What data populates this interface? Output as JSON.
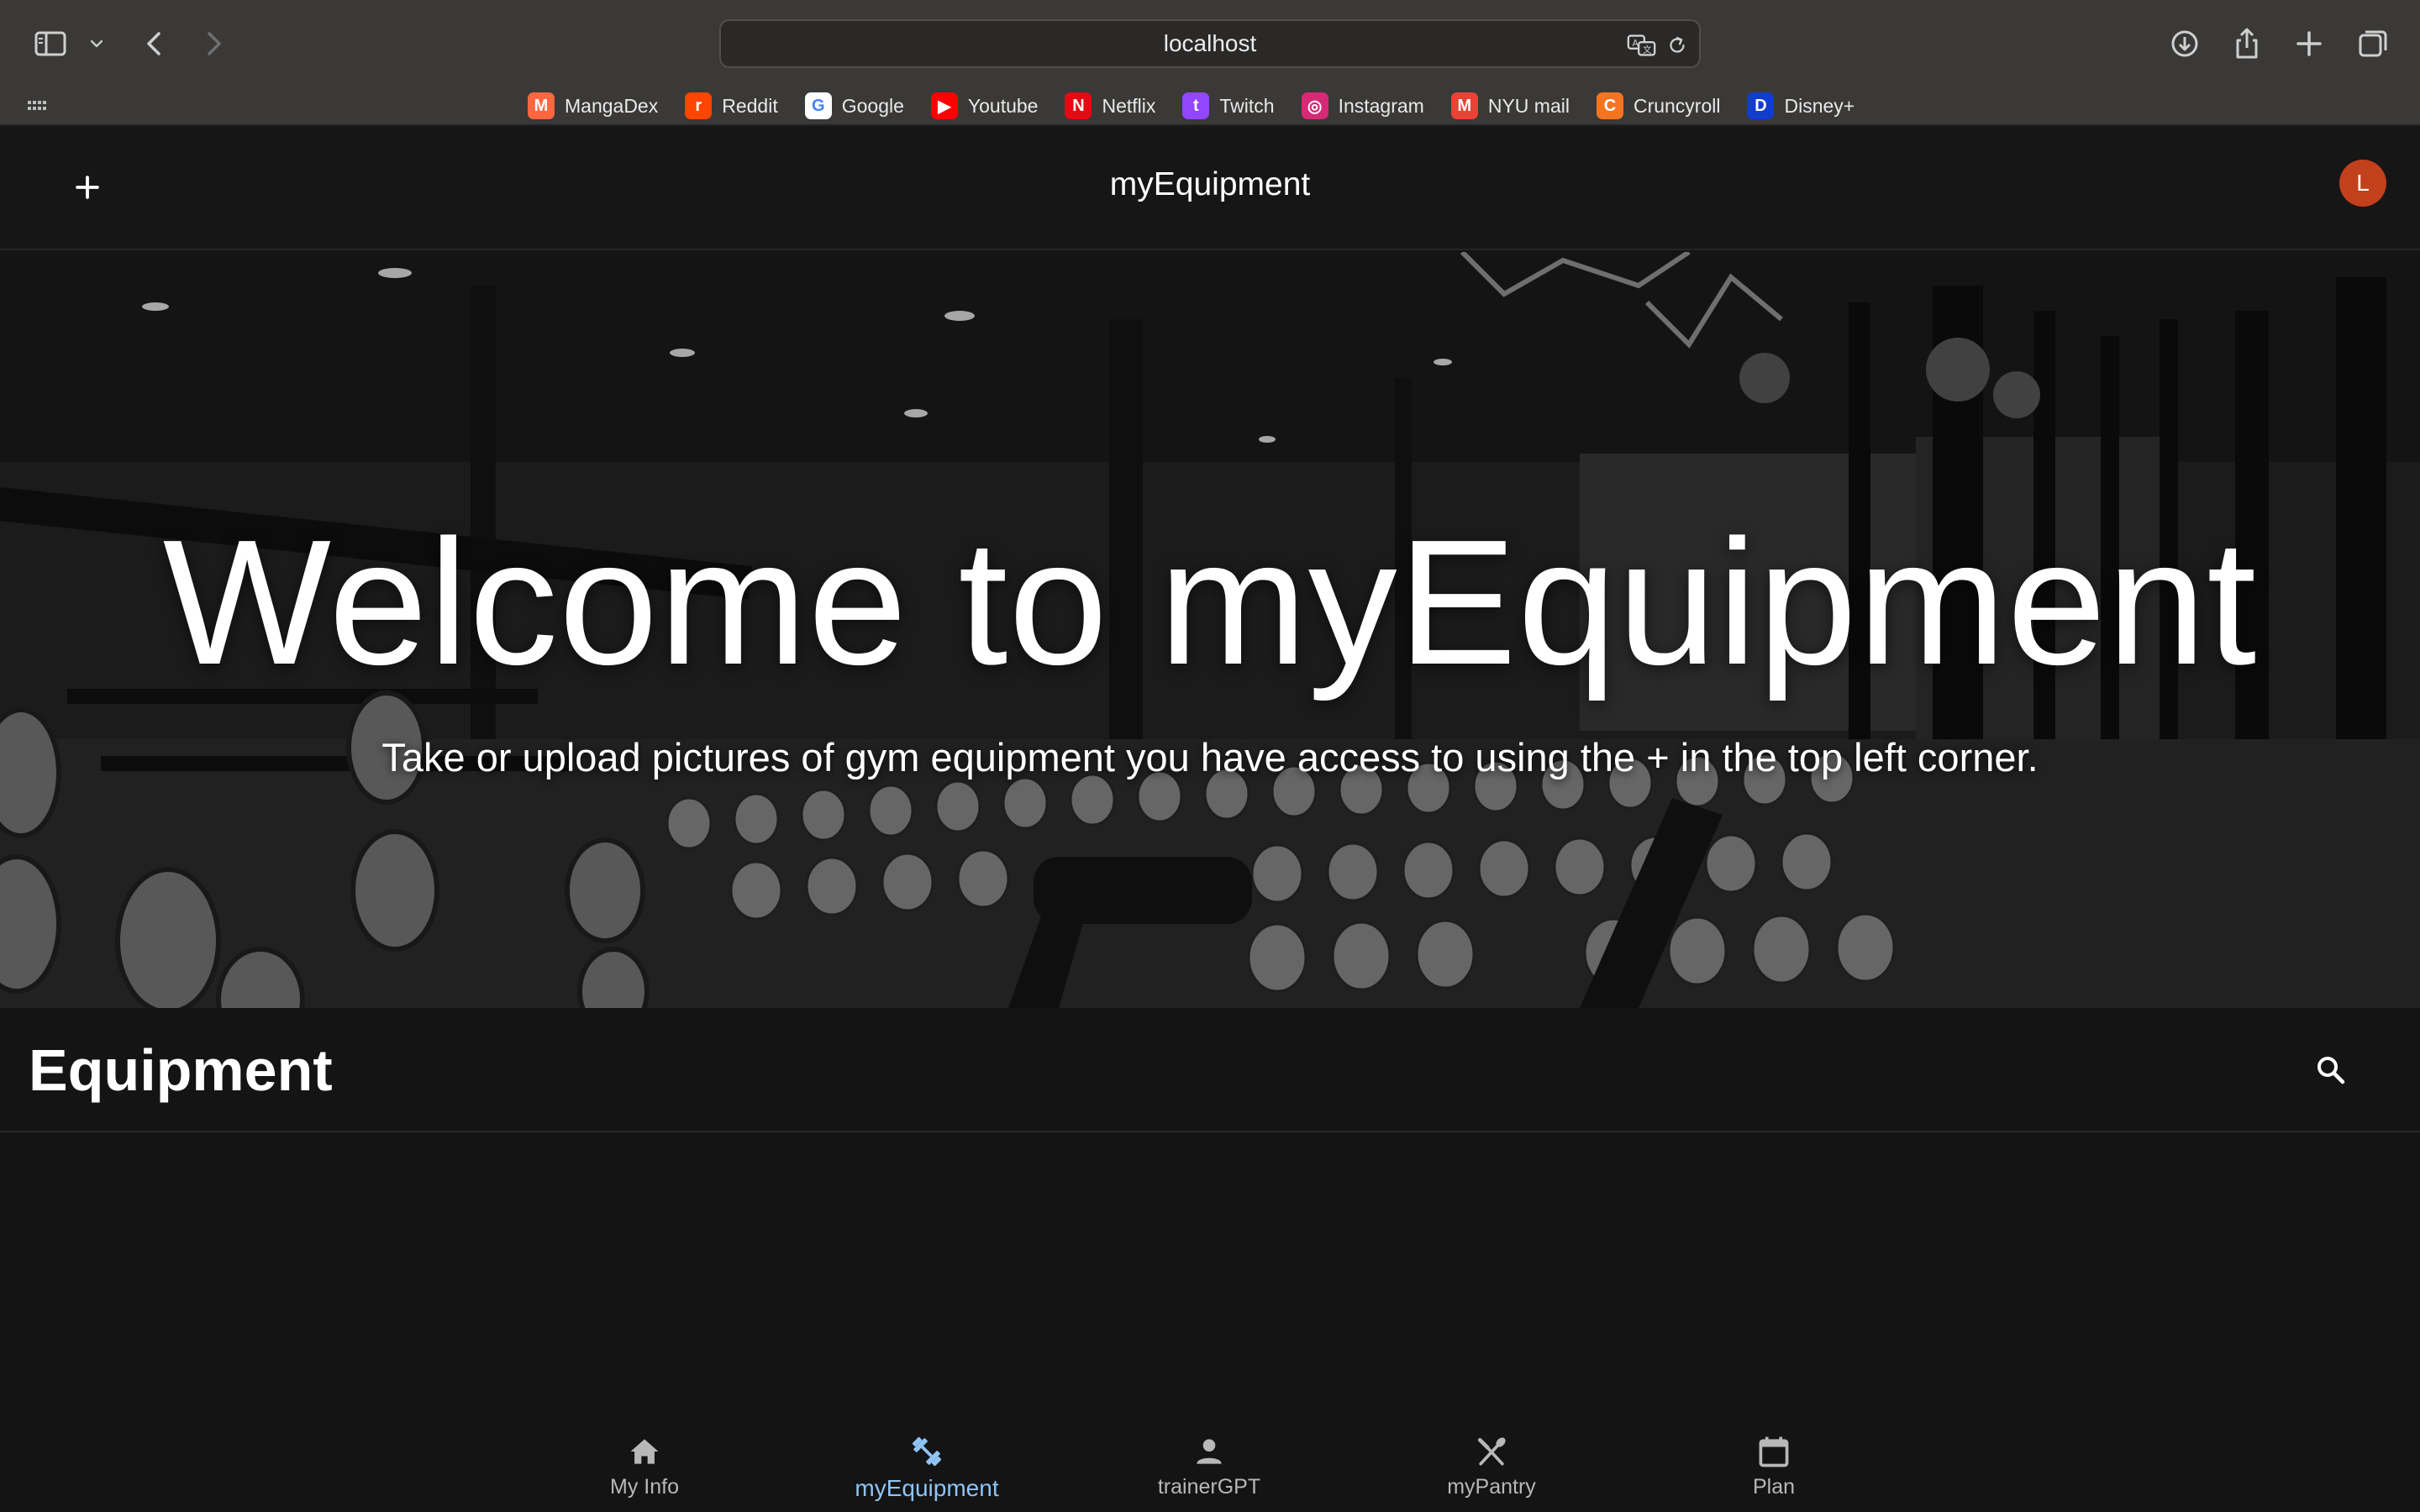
{
  "browser": {
    "url": "localhost",
    "bookmarks": [
      {
        "label": "MangaDex",
        "icon": "mangadex-icon",
        "color": "#ff6740",
        "glyph": "M"
      },
      {
        "label": "Reddit",
        "icon": "reddit-icon",
        "color": "#ff4500",
        "glyph": "r"
      },
      {
        "label": "Google",
        "icon": "google-icon",
        "color": "#ffffff",
        "glyph": "G"
      },
      {
        "label": "Youtube",
        "icon": "youtube-icon",
        "color": "#ff0000",
        "glyph": "▶"
      },
      {
        "label": "Netflix",
        "icon": "netflix-icon",
        "color": "#e50914",
        "glyph": "N"
      },
      {
        "label": "Twitch",
        "icon": "twitch-icon",
        "color": "#9146ff",
        "glyph": "t"
      },
      {
        "label": "Instagram",
        "icon": "instagram-icon",
        "color": "#d62976",
        "glyph": "◎"
      },
      {
        "label": "NYU mail",
        "icon": "gmail-icon",
        "color": "#ea4335",
        "glyph": "M"
      },
      {
        "label": "Cruncyroll",
        "icon": "crunchyroll-icon",
        "color": "#f47521",
        "glyph": "C"
      },
      {
        "label": "Disney+",
        "icon": "disney-plus-icon",
        "color": "#113ccf",
        "glyph": "D"
      }
    ]
  },
  "app": {
    "title": "myEquipment",
    "avatar_initial": "L",
    "avatar_color": "#c2401b"
  },
  "hero": {
    "title": "Welcome to myEquipment",
    "subtitle": "Take or upload pictures of gym equipment you have access to using the + in the top left corner."
  },
  "section": {
    "title": "Equipment"
  },
  "nav": {
    "items": [
      {
        "label": "My Info",
        "icon": "home-icon",
        "active": false
      },
      {
        "label": "myEquipment",
        "icon": "dumbbell-icon",
        "active": true
      },
      {
        "label": "trainerGPT",
        "icon": "person-icon",
        "active": false
      },
      {
        "label": "myPantry",
        "icon": "utensils-icon",
        "active": false
      },
      {
        "label": "Plan",
        "icon": "calendar-icon",
        "active": false
      }
    ],
    "active_color": "#8fc4f5",
    "inactive_color": "#b8b8b8"
  }
}
